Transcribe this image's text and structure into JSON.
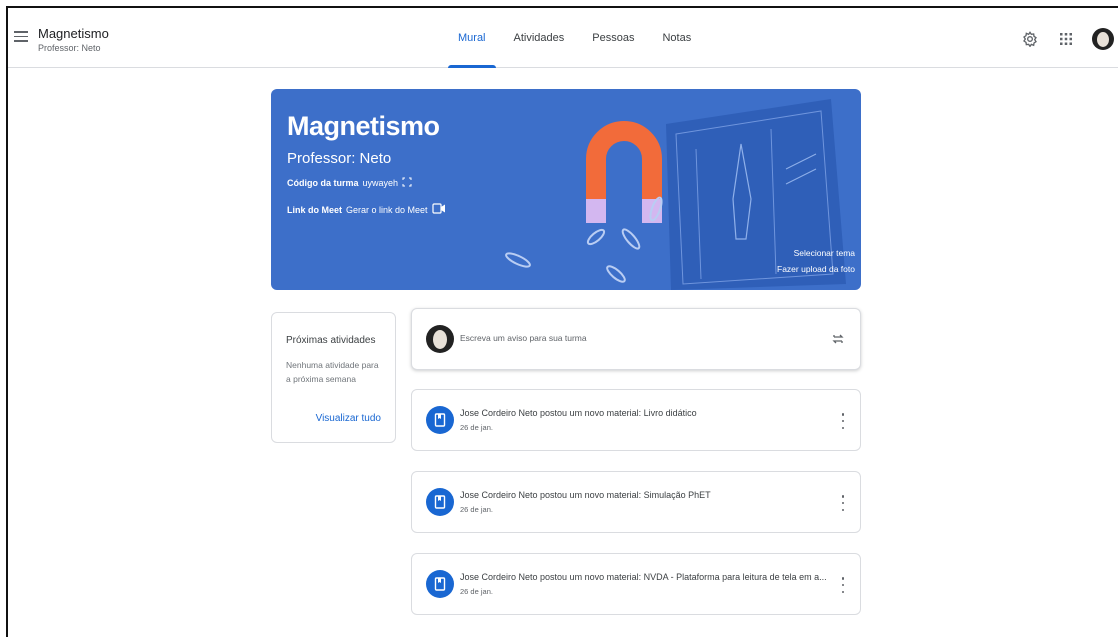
{
  "header": {
    "class_title": "Magnetismo",
    "class_subtitle": "Professor: Neto",
    "tabs": [
      {
        "label": "Mural",
        "active": true
      },
      {
        "label": "Atividades",
        "active": false
      },
      {
        "label": "Pessoas",
        "active": false
      },
      {
        "label": "Notas",
        "active": false
      }
    ],
    "icons": [
      "menu-icon",
      "settings-icon",
      "apps-grid-icon",
      "avatar"
    ]
  },
  "banner": {
    "title": "Magnetismo",
    "professor": "Professor: Neto",
    "code_label": "Código da turma",
    "code_value": "uywayeh",
    "meet_label": "Link do Meet",
    "meet_value": "Gerar o link do Meet",
    "select_theme": "Selecionar tema",
    "upload_photo": "Fazer upload da foto",
    "color": "#3d6fc9"
  },
  "upcoming": {
    "title": "Próximas atividades",
    "empty_text": "Nenhuma atividade para a próxima semana",
    "view_all": "Visualizar tudo"
  },
  "composer": {
    "placeholder": "Escreva um aviso para sua turma"
  },
  "posts": [
    {
      "text": "Jose Cordeiro Neto postou um novo material: Livro didático",
      "date": "26 de jan."
    },
    {
      "text": "Jose Cordeiro Neto postou um novo material: Simulação PhET",
      "date": "26 de jan."
    },
    {
      "text": "Jose Cordeiro Neto postou um novo material: NVDA - Plataforma para leitura de tela em a...",
      "date": "26 de jan."
    }
  ],
  "accent_color": "#1967d2"
}
